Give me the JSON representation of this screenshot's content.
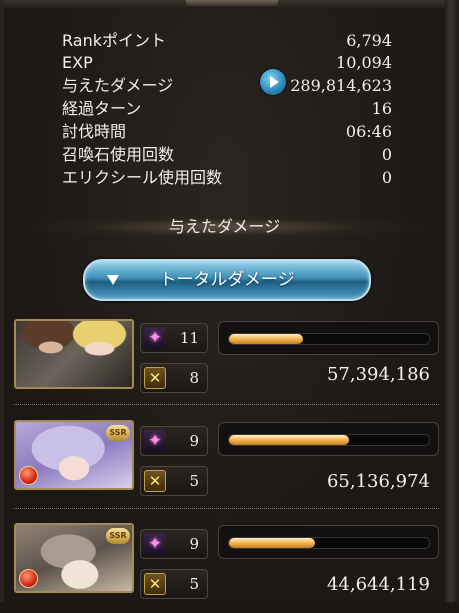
{
  "stats": [
    {
      "label": "Rankポイント",
      "value": "6,794"
    },
    {
      "label": "EXP",
      "value": "10,094"
    },
    {
      "label": "与えたダメージ",
      "value": "289,814,623"
    },
    {
      "label": "経過ターン",
      "value": "16"
    },
    {
      "label": "討伐時間",
      "value": "06:46"
    },
    {
      "label": "召喚石使用回数",
      "value": "0"
    },
    {
      "label": "エリクシール使用回数",
      "value": "0"
    }
  ],
  "section_title": "与えたダメージ",
  "dropdown": {
    "selected": "トータルダメージ"
  },
  "characters": [
    {
      "skill_count": "11",
      "ougi_count": "8",
      "damage": "57,394,186",
      "bar_fraction": 0.37
    },
    {
      "skill_count": "9",
      "ougi_count": "5",
      "damage": "65,136,974",
      "bar_fraction": 0.6,
      "badge": "SSR"
    },
    {
      "skill_count": "9",
      "ougi_count": "5",
      "damage": "44,644,119",
      "bar_fraction": 0.43,
      "badge": "SSR"
    }
  ],
  "colors": {
    "bar_fill": "#f1b44e",
    "button_blue": "#3d8db5",
    "frame_gold": "#a58a56"
  },
  "icons": {
    "skill": "sparkle-icon",
    "ougi": "crossed-swords-icon",
    "element": "fire-element-icon",
    "play": "play-icon"
  }
}
